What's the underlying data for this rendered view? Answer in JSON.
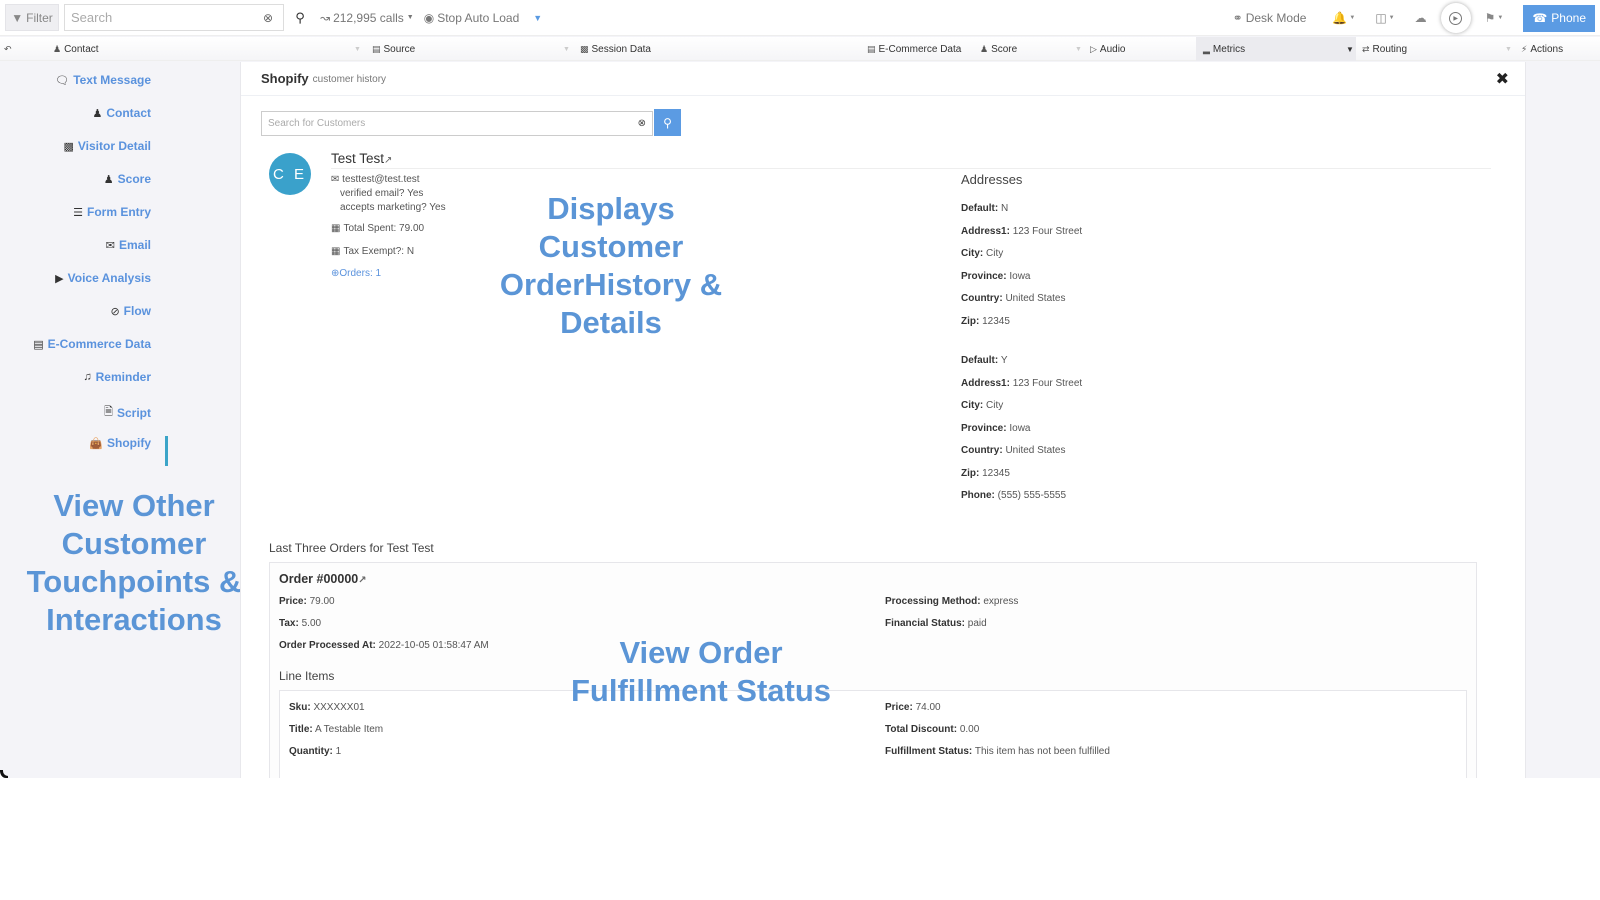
{
  "toolbar": {
    "filter_label": "Filter",
    "search_placeholder": "Search",
    "calls_label": "212,995 calls",
    "stop_auto_load_label": "Stop Auto Load",
    "desk_mode_label": "Desk Mode",
    "phone_label": "Phone",
    "icons": {
      "filter": "filter-icon",
      "clear": "clear-icon",
      "search": "search-icon",
      "calls": "chart-icon",
      "stop": "record-icon",
      "desk": "headset-icon",
      "bell": "bell-icon",
      "columns": "columns-icon",
      "cloud": "cloud-download-icon",
      "play": "play-icon",
      "flag": "flag-icon",
      "phone": "phone-icon"
    }
  },
  "columns": [
    {
      "label": "Contact",
      "icon": "user-icon"
    },
    {
      "label": "Source",
      "icon": "source-icon"
    },
    {
      "label": "Session Data",
      "icon": "bar-chart-icon"
    },
    {
      "label": "E-Commerce Data",
      "icon": "credit-card-icon"
    },
    {
      "label": "Score",
      "icon": "score-icon"
    },
    {
      "label": "Audio",
      "icon": "play-icon"
    },
    {
      "label": "Metrics",
      "icon": "signal-icon"
    },
    {
      "label": "Routing",
      "icon": "routing-icon"
    },
    {
      "label": "Actions",
      "icon": "bolt-icon"
    }
  ],
  "sidebar": {
    "items": [
      {
        "label": "Text Message",
        "icon": "comment-icon"
      },
      {
        "label": "Contact",
        "icon": "user-icon"
      },
      {
        "label": "Visitor Detail",
        "icon": "bar-chart-icon"
      },
      {
        "label": "Score",
        "icon": "score-icon"
      },
      {
        "label": "Form Entry",
        "icon": "list-icon"
      },
      {
        "label": "Email",
        "icon": "envelope-icon"
      },
      {
        "label": "Voice Analysis",
        "icon": "play-circle-icon"
      },
      {
        "label": "Flow",
        "icon": "compass-icon"
      },
      {
        "label": "E-Commerce Data",
        "icon": "credit-card-icon"
      },
      {
        "label": "Reminder",
        "icon": "bell-icon"
      },
      {
        "label": "Script",
        "icon": "file-icon"
      },
      {
        "label": "Shopify",
        "icon": "shopping-bag-icon",
        "active": true
      }
    ]
  },
  "panel": {
    "title": "Shopify",
    "subtitle": "customer history",
    "search_placeholder": "Search for Customers",
    "customer": {
      "initials": "C E",
      "name": "Test Test",
      "email": "testtest@test.test",
      "verified_email": "verified email? Yes",
      "accepts_marketing": "accepts marketing? Yes",
      "total_spent": "Total Spent: 79.00",
      "tax_exempt": "Tax Exempt?: N",
      "orders_link": "Orders: 1"
    },
    "addresses": {
      "title": "Addresses",
      "list": [
        {
          "Default": "N",
          "Address1": "123 Four Street",
          "City": "City",
          "Province": "Iowa",
          "Country": "United States",
          "Zip": "12345"
        },
        {
          "Default": "Y",
          "Address1": "123 Four Street",
          "City": "City",
          "Province": "Iowa",
          "Country": "United States",
          "Zip": "12345",
          "Phone": "(555) 555-5555"
        }
      ]
    },
    "orders_title": "Last Three Orders for Test Test",
    "order": {
      "number": "Order #00000",
      "price_label": "Price:",
      "price": "79.00",
      "tax_label": "Tax:",
      "tax": "5.00",
      "processed_label": "Order Processed At:",
      "processed": "2022-10-05 01:58:47 AM",
      "method_label": "Processing Method:",
      "method": "express",
      "financial_label": "Financial Status:",
      "financial": "paid",
      "line_items_title": "Line Items",
      "line_item": {
        "sku_label": "Sku:",
        "sku": "XXXXXX01",
        "title_label": "Title:",
        "title": "A Testable Item",
        "qty_label": "Quantity:",
        "qty": "1",
        "price_label": "Price:",
        "price": "74.00",
        "discount_label": "Total Discount:",
        "discount": "0.00",
        "fulfillment_label": "Fulfillment Status:",
        "fulfillment": "This item has not been fulfilled"
      }
    }
  },
  "annotations": {
    "left": "View Other Customer Touchpoints & Interactions",
    "middle": "Displays Customer OrderHistory & Details",
    "bottom": "View Order Fulfillment Status"
  },
  "address_labels": {
    "default": "Default:",
    "address1": "Address1:",
    "city": "City:",
    "province": "Province:",
    "country": "Country:",
    "zip": "Zip:",
    "phone": "Phone:"
  },
  "colors": {
    "accent": "#5b9be3",
    "link": "#5a92dd",
    "avatar": "#3aa1cb",
    "annotation": "#5b95d6"
  }
}
